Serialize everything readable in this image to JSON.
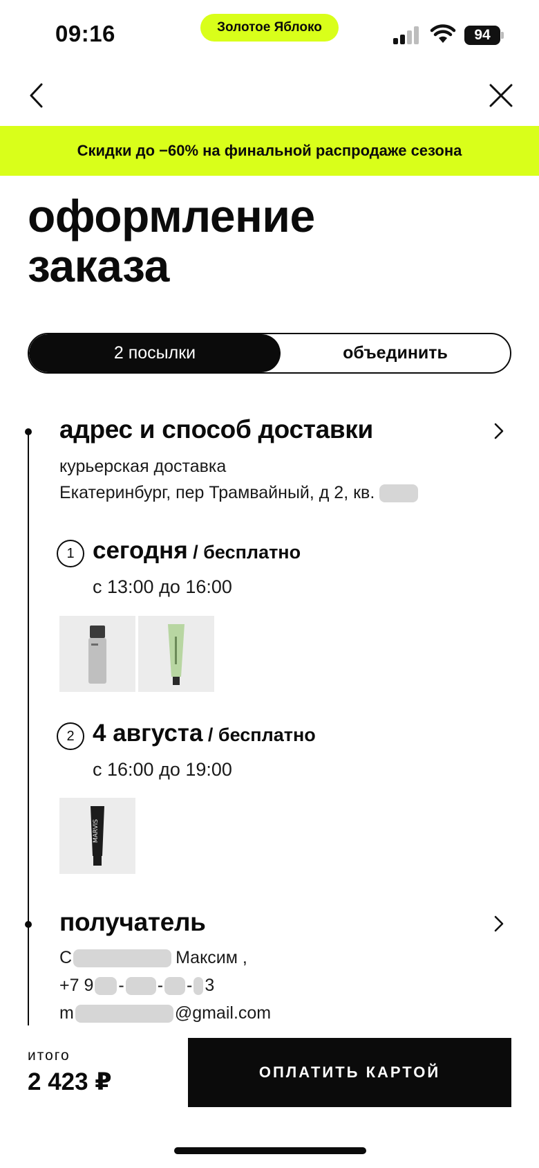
{
  "status_bar": {
    "time": "09:16",
    "app_pill": "Золотое Яблоко",
    "battery": "94"
  },
  "promo_banner": "Скидки до −60% на финальной распродаже сезона",
  "page_title": "оформление заказа",
  "segmented": {
    "active": "2 посылки",
    "inactive": "объединить"
  },
  "delivery": {
    "title": "адрес и способ доставки",
    "method": "курьерская доставка",
    "address": "Екатеринбург, пер Трамвайный, д 2, кв."
  },
  "shipments": [
    {
      "number": "1",
      "date": "сегодня",
      "price": " / бесплатно",
      "time": "с 13:00 до 16:00",
      "items": [
        "серый флакон",
        "зелёный тюбик"
      ]
    },
    {
      "number": "2",
      "date": "4 августа",
      "price": " / бесплатно",
      "time": "с 16:00 до 19:00",
      "items": [
        "MARVIS"
      ]
    }
  ],
  "recipient": {
    "title": "получатель",
    "name_start": "С",
    "name_end": "Максим ,",
    "phone_start": "+7 9",
    "phone_end": "3",
    "email_start": "m",
    "email_end": "@gmail.com"
  },
  "footer": {
    "total_label": "итого",
    "total_value": "2 423 ₽",
    "pay_button": "ОПЛАТИТЬ КАРТОЙ"
  },
  "colors": {
    "accent": "#d9ff1a",
    "text": "#0b0b0b"
  }
}
